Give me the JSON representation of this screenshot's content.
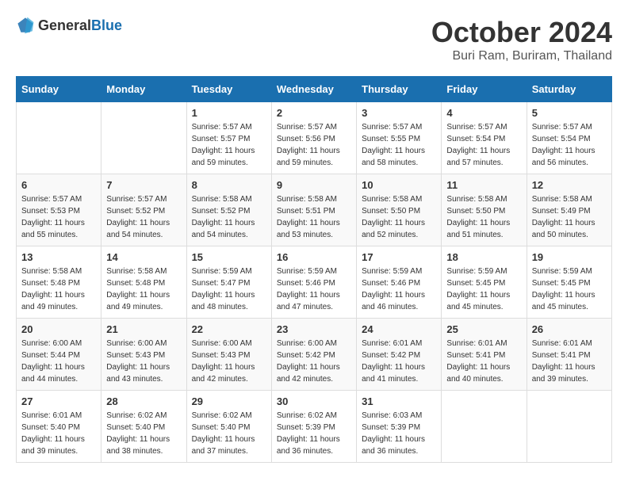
{
  "header": {
    "logo_general": "General",
    "logo_blue": "Blue",
    "month": "October 2024",
    "location": "Buri Ram, Buriram, Thailand"
  },
  "weekdays": [
    "Sunday",
    "Monday",
    "Tuesday",
    "Wednesday",
    "Thursday",
    "Friday",
    "Saturday"
  ],
  "weeks": [
    [
      {
        "day": "",
        "info": ""
      },
      {
        "day": "",
        "info": ""
      },
      {
        "day": "1",
        "info": "Sunrise: 5:57 AM\nSunset: 5:57 PM\nDaylight: 11 hours and 59 minutes."
      },
      {
        "day": "2",
        "info": "Sunrise: 5:57 AM\nSunset: 5:56 PM\nDaylight: 11 hours and 59 minutes."
      },
      {
        "day": "3",
        "info": "Sunrise: 5:57 AM\nSunset: 5:55 PM\nDaylight: 11 hours and 58 minutes."
      },
      {
        "day": "4",
        "info": "Sunrise: 5:57 AM\nSunset: 5:54 PM\nDaylight: 11 hours and 57 minutes."
      },
      {
        "day": "5",
        "info": "Sunrise: 5:57 AM\nSunset: 5:54 PM\nDaylight: 11 hours and 56 minutes."
      }
    ],
    [
      {
        "day": "6",
        "info": "Sunrise: 5:57 AM\nSunset: 5:53 PM\nDaylight: 11 hours and 55 minutes."
      },
      {
        "day": "7",
        "info": "Sunrise: 5:57 AM\nSunset: 5:52 PM\nDaylight: 11 hours and 54 minutes."
      },
      {
        "day": "8",
        "info": "Sunrise: 5:58 AM\nSunset: 5:52 PM\nDaylight: 11 hours and 54 minutes."
      },
      {
        "day": "9",
        "info": "Sunrise: 5:58 AM\nSunset: 5:51 PM\nDaylight: 11 hours and 53 minutes."
      },
      {
        "day": "10",
        "info": "Sunrise: 5:58 AM\nSunset: 5:50 PM\nDaylight: 11 hours and 52 minutes."
      },
      {
        "day": "11",
        "info": "Sunrise: 5:58 AM\nSunset: 5:50 PM\nDaylight: 11 hours and 51 minutes."
      },
      {
        "day": "12",
        "info": "Sunrise: 5:58 AM\nSunset: 5:49 PM\nDaylight: 11 hours and 50 minutes."
      }
    ],
    [
      {
        "day": "13",
        "info": "Sunrise: 5:58 AM\nSunset: 5:48 PM\nDaylight: 11 hours and 49 minutes."
      },
      {
        "day": "14",
        "info": "Sunrise: 5:58 AM\nSunset: 5:48 PM\nDaylight: 11 hours and 49 minutes."
      },
      {
        "day": "15",
        "info": "Sunrise: 5:59 AM\nSunset: 5:47 PM\nDaylight: 11 hours and 48 minutes."
      },
      {
        "day": "16",
        "info": "Sunrise: 5:59 AM\nSunset: 5:46 PM\nDaylight: 11 hours and 47 minutes."
      },
      {
        "day": "17",
        "info": "Sunrise: 5:59 AM\nSunset: 5:46 PM\nDaylight: 11 hours and 46 minutes."
      },
      {
        "day": "18",
        "info": "Sunrise: 5:59 AM\nSunset: 5:45 PM\nDaylight: 11 hours and 45 minutes."
      },
      {
        "day": "19",
        "info": "Sunrise: 5:59 AM\nSunset: 5:45 PM\nDaylight: 11 hours and 45 minutes."
      }
    ],
    [
      {
        "day": "20",
        "info": "Sunrise: 6:00 AM\nSunset: 5:44 PM\nDaylight: 11 hours and 44 minutes."
      },
      {
        "day": "21",
        "info": "Sunrise: 6:00 AM\nSunset: 5:43 PM\nDaylight: 11 hours and 43 minutes."
      },
      {
        "day": "22",
        "info": "Sunrise: 6:00 AM\nSunset: 5:43 PM\nDaylight: 11 hours and 42 minutes."
      },
      {
        "day": "23",
        "info": "Sunrise: 6:00 AM\nSunset: 5:42 PM\nDaylight: 11 hours and 42 minutes."
      },
      {
        "day": "24",
        "info": "Sunrise: 6:01 AM\nSunset: 5:42 PM\nDaylight: 11 hours and 41 minutes."
      },
      {
        "day": "25",
        "info": "Sunrise: 6:01 AM\nSunset: 5:41 PM\nDaylight: 11 hours and 40 minutes."
      },
      {
        "day": "26",
        "info": "Sunrise: 6:01 AM\nSunset: 5:41 PM\nDaylight: 11 hours and 39 minutes."
      }
    ],
    [
      {
        "day": "27",
        "info": "Sunrise: 6:01 AM\nSunset: 5:40 PM\nDaylight: 11 hours and 39 minutes."
      },
      {
        "day": "28",
        "info": "Sunrise: 6:02 AM\nSunset: 5:40 PM\nDaylight: 11 hours and 38 minutes."
      },
      {
        "day": "29",
        "info": "Sunrise: 6:02 AM\nSunset: 5:40 PM\nDaylight: 11 hours and 37 minutes."
      },
      {
        "day": "30",
        "info": "Sunrise: 6:02 AM\nSunset: 5:39 PM\nDaylight: 11 hours and 36 minutes."
      },
      {
        "day": "31",
        "info": "Sunrise: 6:03 AM\nSunset: 5:39 PM\nDaylight: 11 hours and 36 minutes."
      },
      {
        "day": "",
        "info": ""
      },
      {
        "day": "",
        "info": ""
      }
    ]
  ]
}
